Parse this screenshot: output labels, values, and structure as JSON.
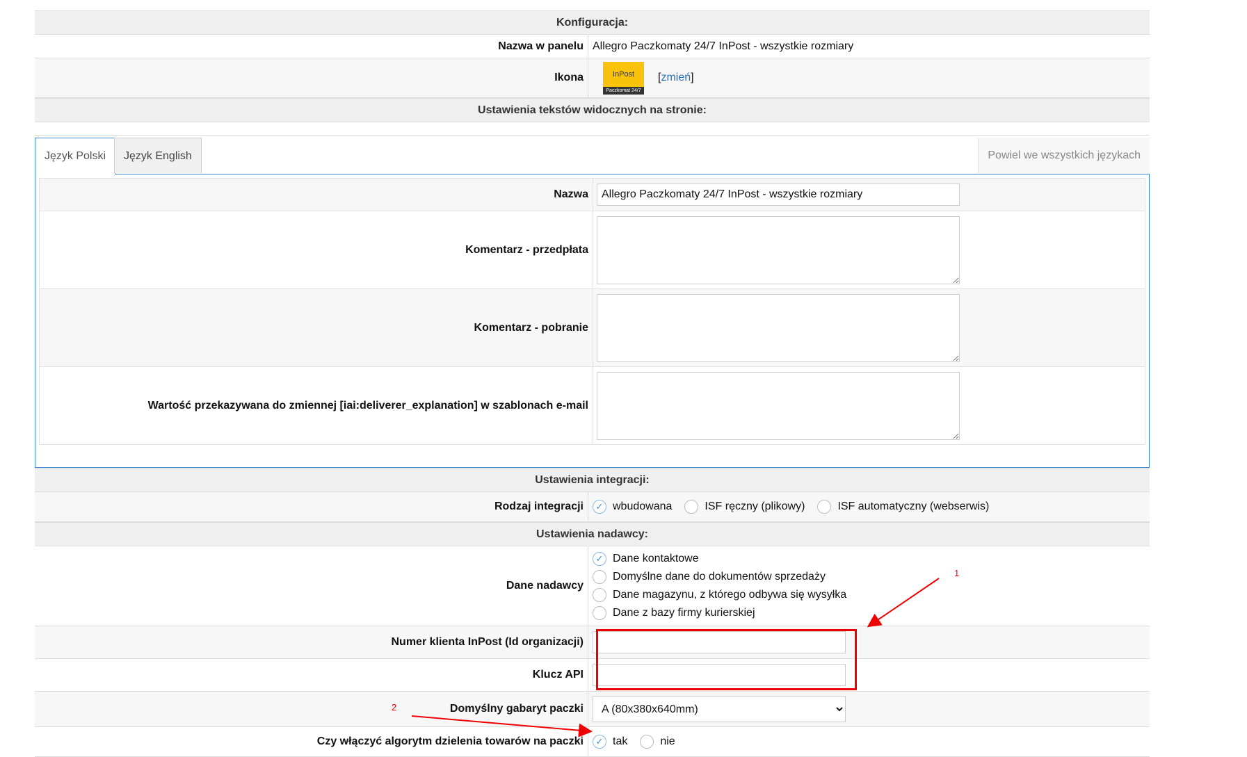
{
  "config_header": "Konfiguracja:",
  "panel_name": {
    "label": "Nazwa w panelu",
    "value": "Allegro Paczkomaty 24/7 InPost - wszystkie rozmiary"
  },
  "icon_row": {
    "label": "Ikona",
    "logo_text": "InPost",
    "logo_sub": "Paczkomat 24/7",
    "change_prefix": "[",
    "change_link": "zmień",
    "change_suffix": "]"
  },
  "texts_header": "Ustawienia tekstów widocznych na stronie:",
  "tabs": [
    {
      "label": "Język Polski",
      "active": true
    },
    {
      "label": "Język English",
      "active": false
    }
  ],
  "copy_all_label": "Powiel we wszystkich językach",
  "lang_fields": {
    "name_label": "Nazwa",
    "name_value": "Allegro Paczkomaty 24/7 InPost - wszystkie rozmiary",
    "prepay_label": "Komentarz - przedpłata",
    "cod_label": "Komentarz - pobranie",
    "email_label": "Wartość przekazywana do zmiennej [iai:deliverer_explanation] w szablonach e-mail"
  },
  "integration_header": "Ustawienia integracji:",
  "integration": {
    "label": "Rodzaj integracji",
    "options": [
      "wbudowana",
      "ISF ręczny (plikowy)",
      "ISF automatyczny (webserwis)"
    ],
    "selected": 0
  },
  "sender_header": "Ustawienia nadawcy:",
  "sender": {
    "label": "Dane nadawcy",
    "options": [
      "Dane kontaktowe",
      "Domyślne dane do dokumentów sprzedaży",
      "Dane magazynu, z którego odbywa się wysyłka",
      "Dane z bazy firmy kurierskiej"
    ],
    "selected": 0
  },
  "client_number": {
    "label": "Numer klienta InPost (Id organizacji)",
    "value": ""
  },
  "api_key": {
    "label": "Klucz API",
    "value": ""
  },
  "default_size": {
    "label": "Domyślny gabaryt paczki",
    "value": "A (80x380x640mm)"
  },
  "split_algorithm": {
    "label": "Czy włączyć algorytm dzielenia towarów na paczki",
    "options": [
      "tak",
      "nie"
    ],
    "selected": 0
  },
  "annotations": {
    "one": "1",
    "two": "2",
    "color": "#e00000"
  },
  "colors": {
    "accent": "#3d8bd8",
    "logo_yellow": "#f9c20b"
  }
}
